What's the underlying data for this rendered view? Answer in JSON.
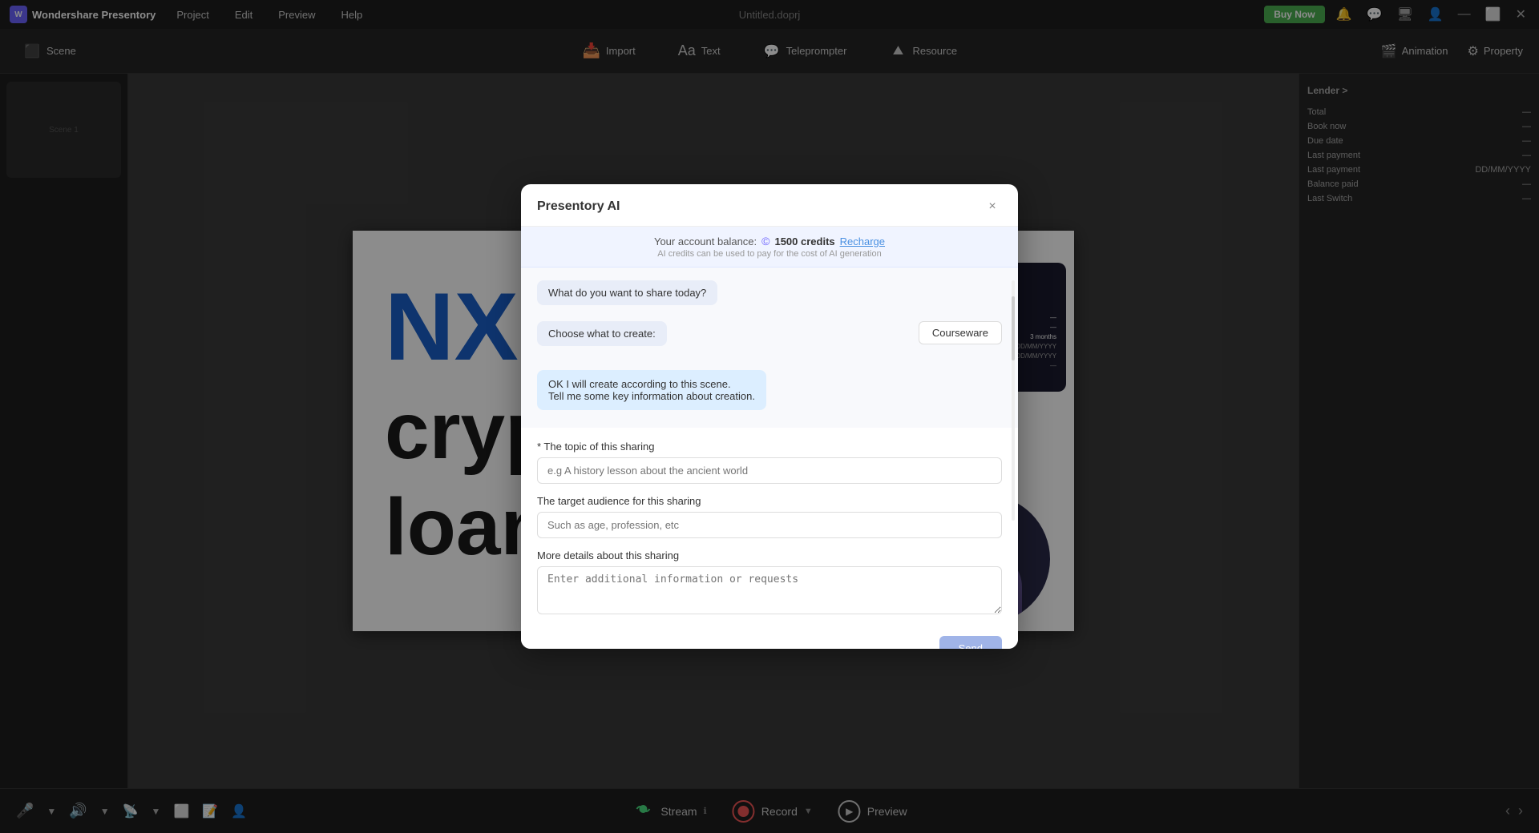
{
  "app": {
    "name": "Wondershare Presentory",
    "title_file": "Untitled.doprj"
  },
  "menu": {
    "project": "Project",
    "edit": "Edit",
    "preview": "Preview",
    "help": "Help",
    "buy_now": "Buy Now"
  },
  "toolbar": {
    "scene": "Scene",
    "import": "Import",
    "text": "Text",
    "teleprompter": "Teleprompter",
    "resource": "Resource",
    "animation": "Animation",
    "property": "Property"
  },
  "bottom_bar": {
    "stream": "Stream",
    "record": "Record",
    "preview": "Preview"
  },
  "modal": {
    "title": "Presentory AI",
    "close_label": "×",
    "credits_label": "Your account balance:",
    "credits_icon": "©",
    "credits_amount": "1500 credits",
    "recharge_label": "Recharge",
    "credits_sub": "AI credits can be used to pay for the cost of AI generation",
    "chat_q1": "What do you want to share today?",
    "chat_q2": "Choose what to create:",
    "courseware_btn": "Courseware",
    "chat_response_line1": "OK   I will create according to this scene.",
    "chat_response_line2": "Tell me some key information about creation.",
    "form": {
      "topic_label": "* The topic of this sharing",
      "topic_placeholder": "e.g A history lesson about the ancient world",
      "audience_label": "The target audience for this sharing",
      "audience_placeholder": "Such as age, profession, etc",
      "details_label": "More details about this sharing",
      "details_placeholder": "Enter additional information or requests",
      "send_btn": "Send"
    }
  }
}
